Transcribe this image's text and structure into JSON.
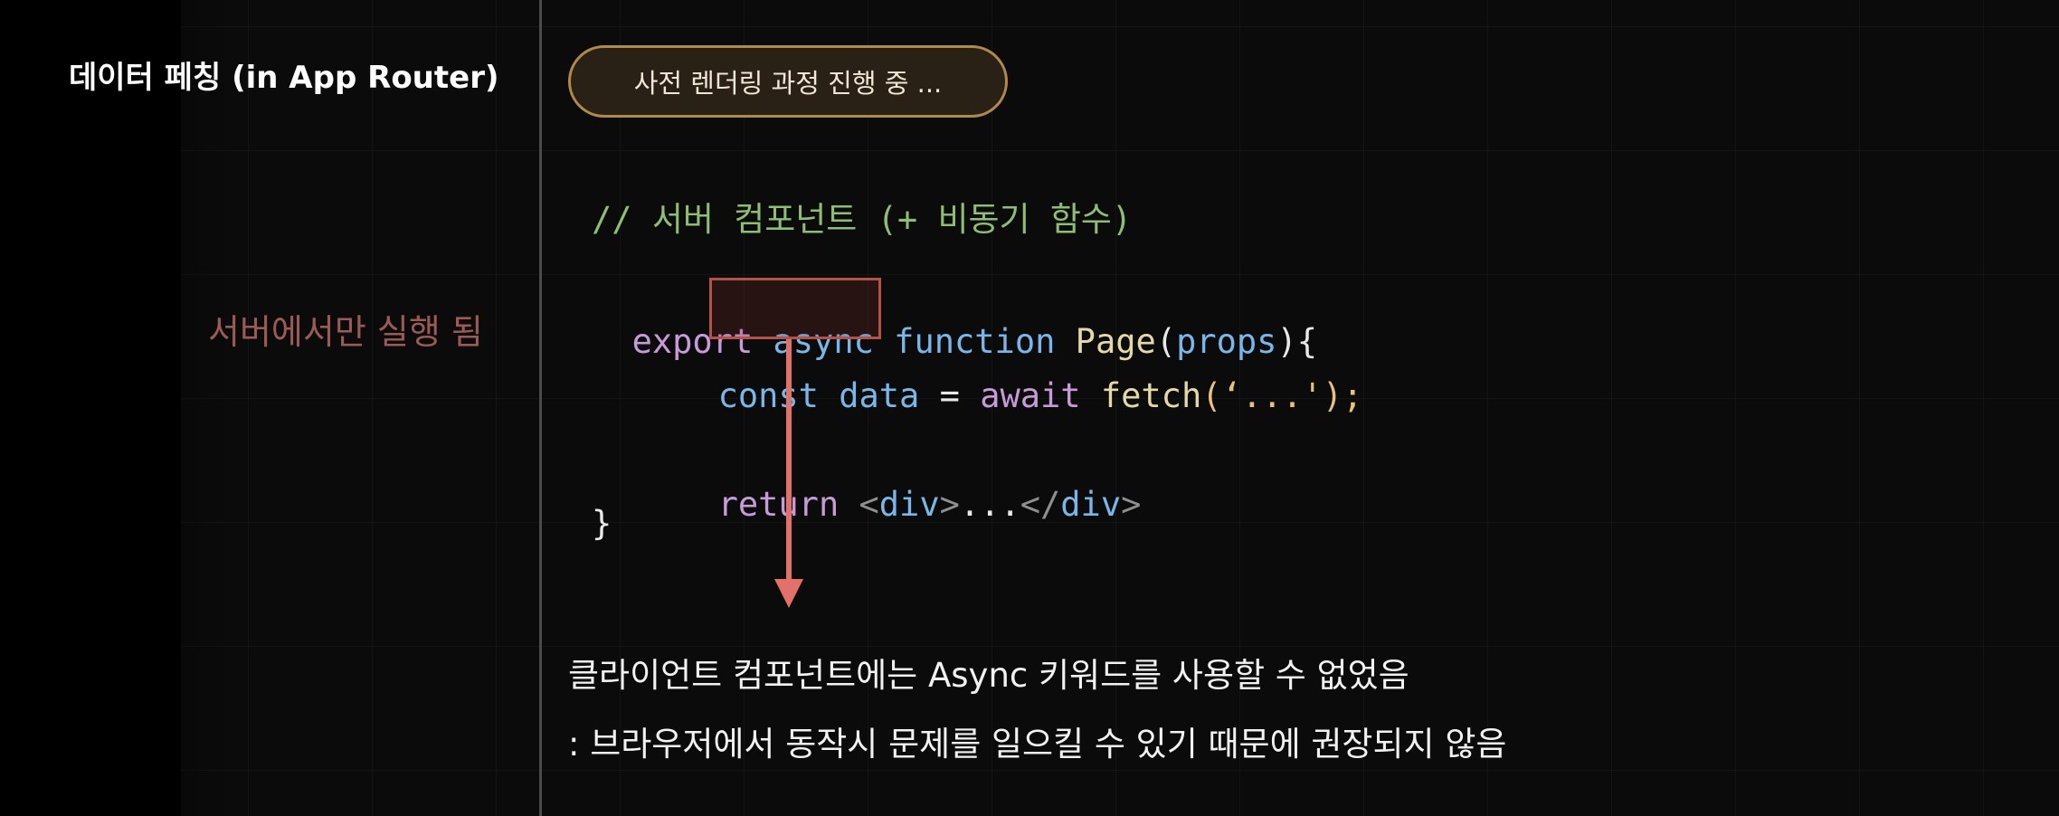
{
  "title": "데이터 페칭 (in App Router)",
  "side_note": "서버에서만 실행 됨",
  "status_pill": "사전 렌더링 과정 진행 중 ...",
  "code": {
    "comment": "// 서버 컴포넌트 (+ 비동기 함수)",
    "line1": {
      "export": "export",
      "async": "async",
      "function": "function",
      "name": "Page",
      "open_paren": "(",
      "param": "props",
      "close": "){"
    },
    "line2": {
      "const": "const",
      "var": "data",
      "eq": "=",
      "await": "await",
      "fetch": "fetch",
      "arg": "(‘...');"
    },
    "line3": {
      "return": "return",
      "open_lt": "<",
      "open_tag": "div",
      "open_gt": ">",
      "dots": "...",
      "close_lt": "</",
      "close_tag": "div",
      "close_gt": ">"
    },
    "line4": "}"
  },
  "description": {
    "line1": "클라이언트 컴포넌트에는 Async 키워드를 사용할 수 없었음",
    "line2": ": 브라우저에서 동작시 문제를 일으킬 수 있기 때문에 권장되지 않음"
  },
  "colors": {
    "accent_red": "#e2716a",
    "pill_border": "#b08a4a",
    "comment": "#8fbd74",
    "keyword": "#c79bd8",
    "identifier": "#7ab7e8"
  }
}
